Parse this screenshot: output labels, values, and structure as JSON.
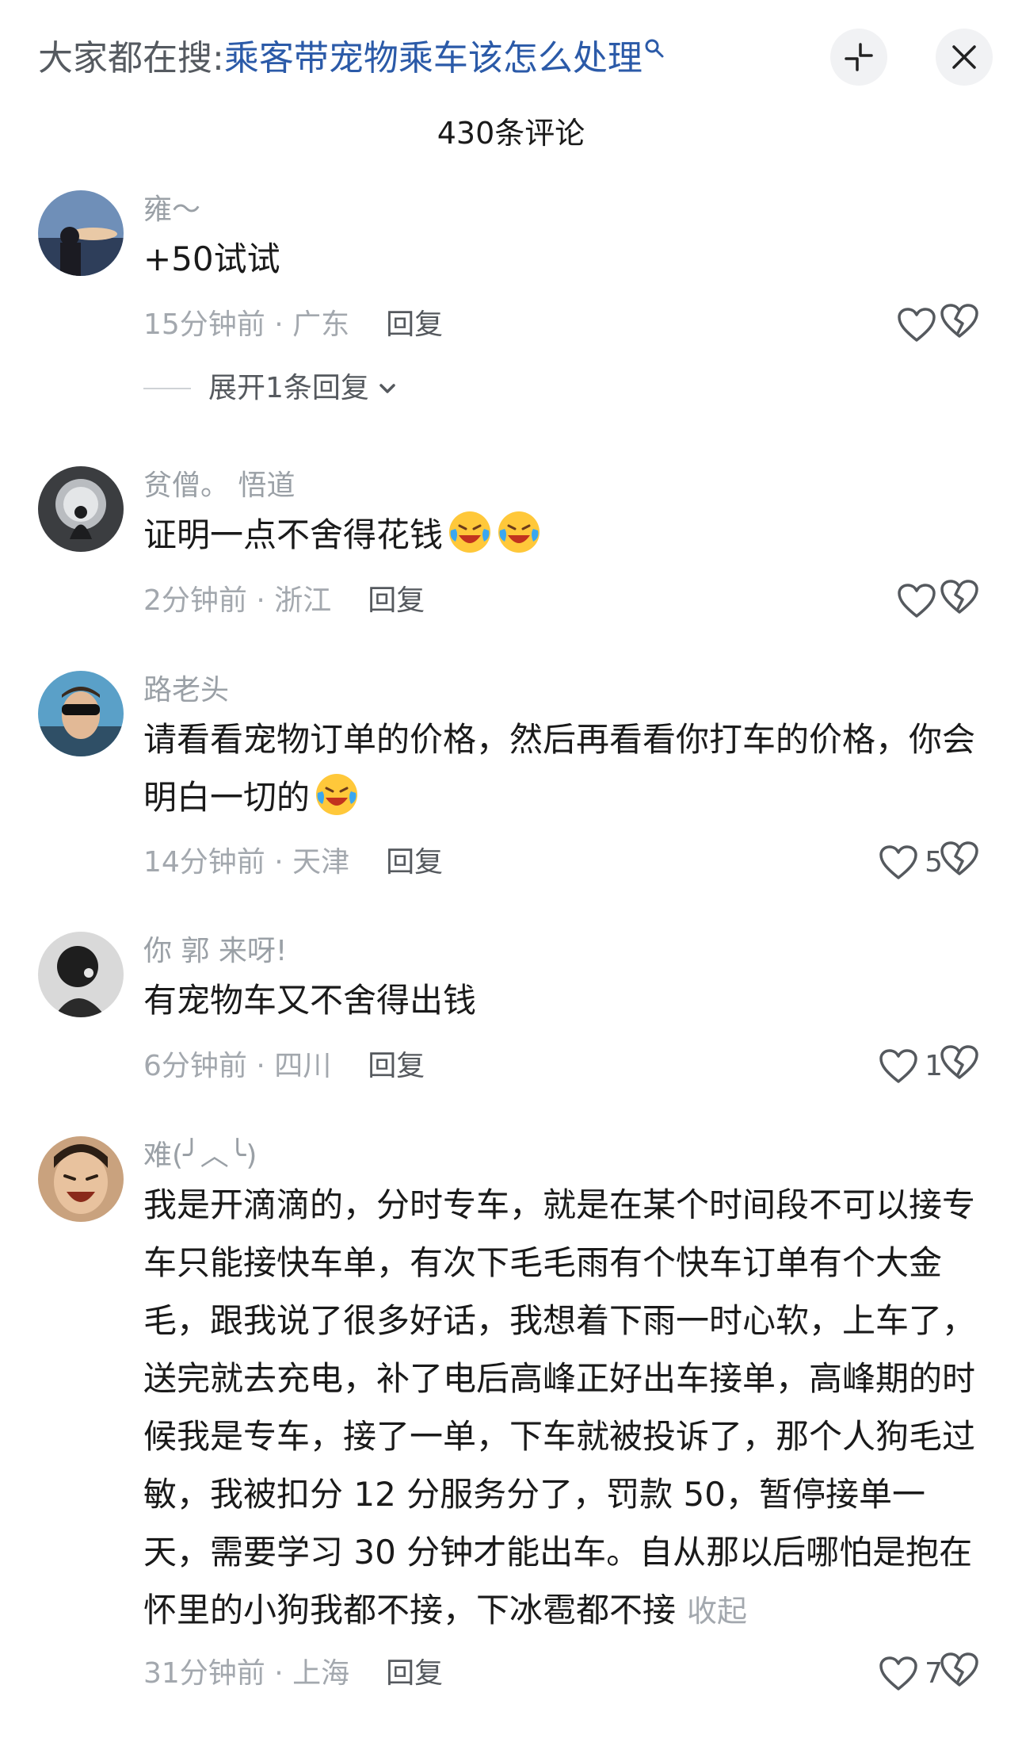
{
  "header": {
    "search_prefix": "大家都在搜:",
    "search_query": "乘客带宠物乘车该怎么处理",
    "collapse_icon": "collapse-arrows-icon",
    "close_icon": "close-icon"
  },
  "comment_count": "430条评论",
  "comments": [
    {
      "username": "雍～",
      "text": "+50试试",
      "time_loc": "15分钟前 · 广东",
      "reply": "回复",
      "likes": "",
      "expand": "展开1条回复"
    },
    {
      "username": "贫僧。 悟道",
      "text": "证明一点不舍得花钱",
      "emoji": [
        "crying-laughing-emoji",
        "crying-laughing-emoji"
      ],
      "time_loc": "2分钟前 · 浙江",
      "reply": "回复",
      "likes": ""
    },
    {
      "username": "路老头",
      "text": "请看看宠物订单的价格，然后再看看你打车的价格，你会明白一切的",
      "emoji": [
        "crying-laughing-emoji"
      ],
      "time_loc": "14分钟前 · 天津",
      "reply": "回复",
      "likes": "5"
    },
    {
      "username": "你 郭 来呀!",
      "text": "有宠物车又不舍得出钱",
      "time_loc": "6分钟前 · 四川",
      "reply": "回复",
      "likes": "1"
    },
    {
      "username": "难(╯︿╰)",
      "text": "我是开滴滴的，分时专车，就是在某个时间段不可以接专车只能接快车单，有次下毛毛雨有个快车订单有个大金毛，跟我说了很多好话，我想着下雨一时心软，上车了，送完就去充电，补了电后高峰正好出车接单，高峰期的时候我是专车，接了一单，下车就被投诉了，那个人狗毛过敏，我被扣分 12 分服务分了，罚款 50，暂停接单一天，需要学习 30 分钟才能出车。自从那以后哪怕是抱在怀里的小狗我都不接，下冰雹都不接",
      "collapse": "收起",
      "time_loc": "31分钟前 · 上海",
      "reply": "回复",
      "likes": "7"
    }
  ]
}
